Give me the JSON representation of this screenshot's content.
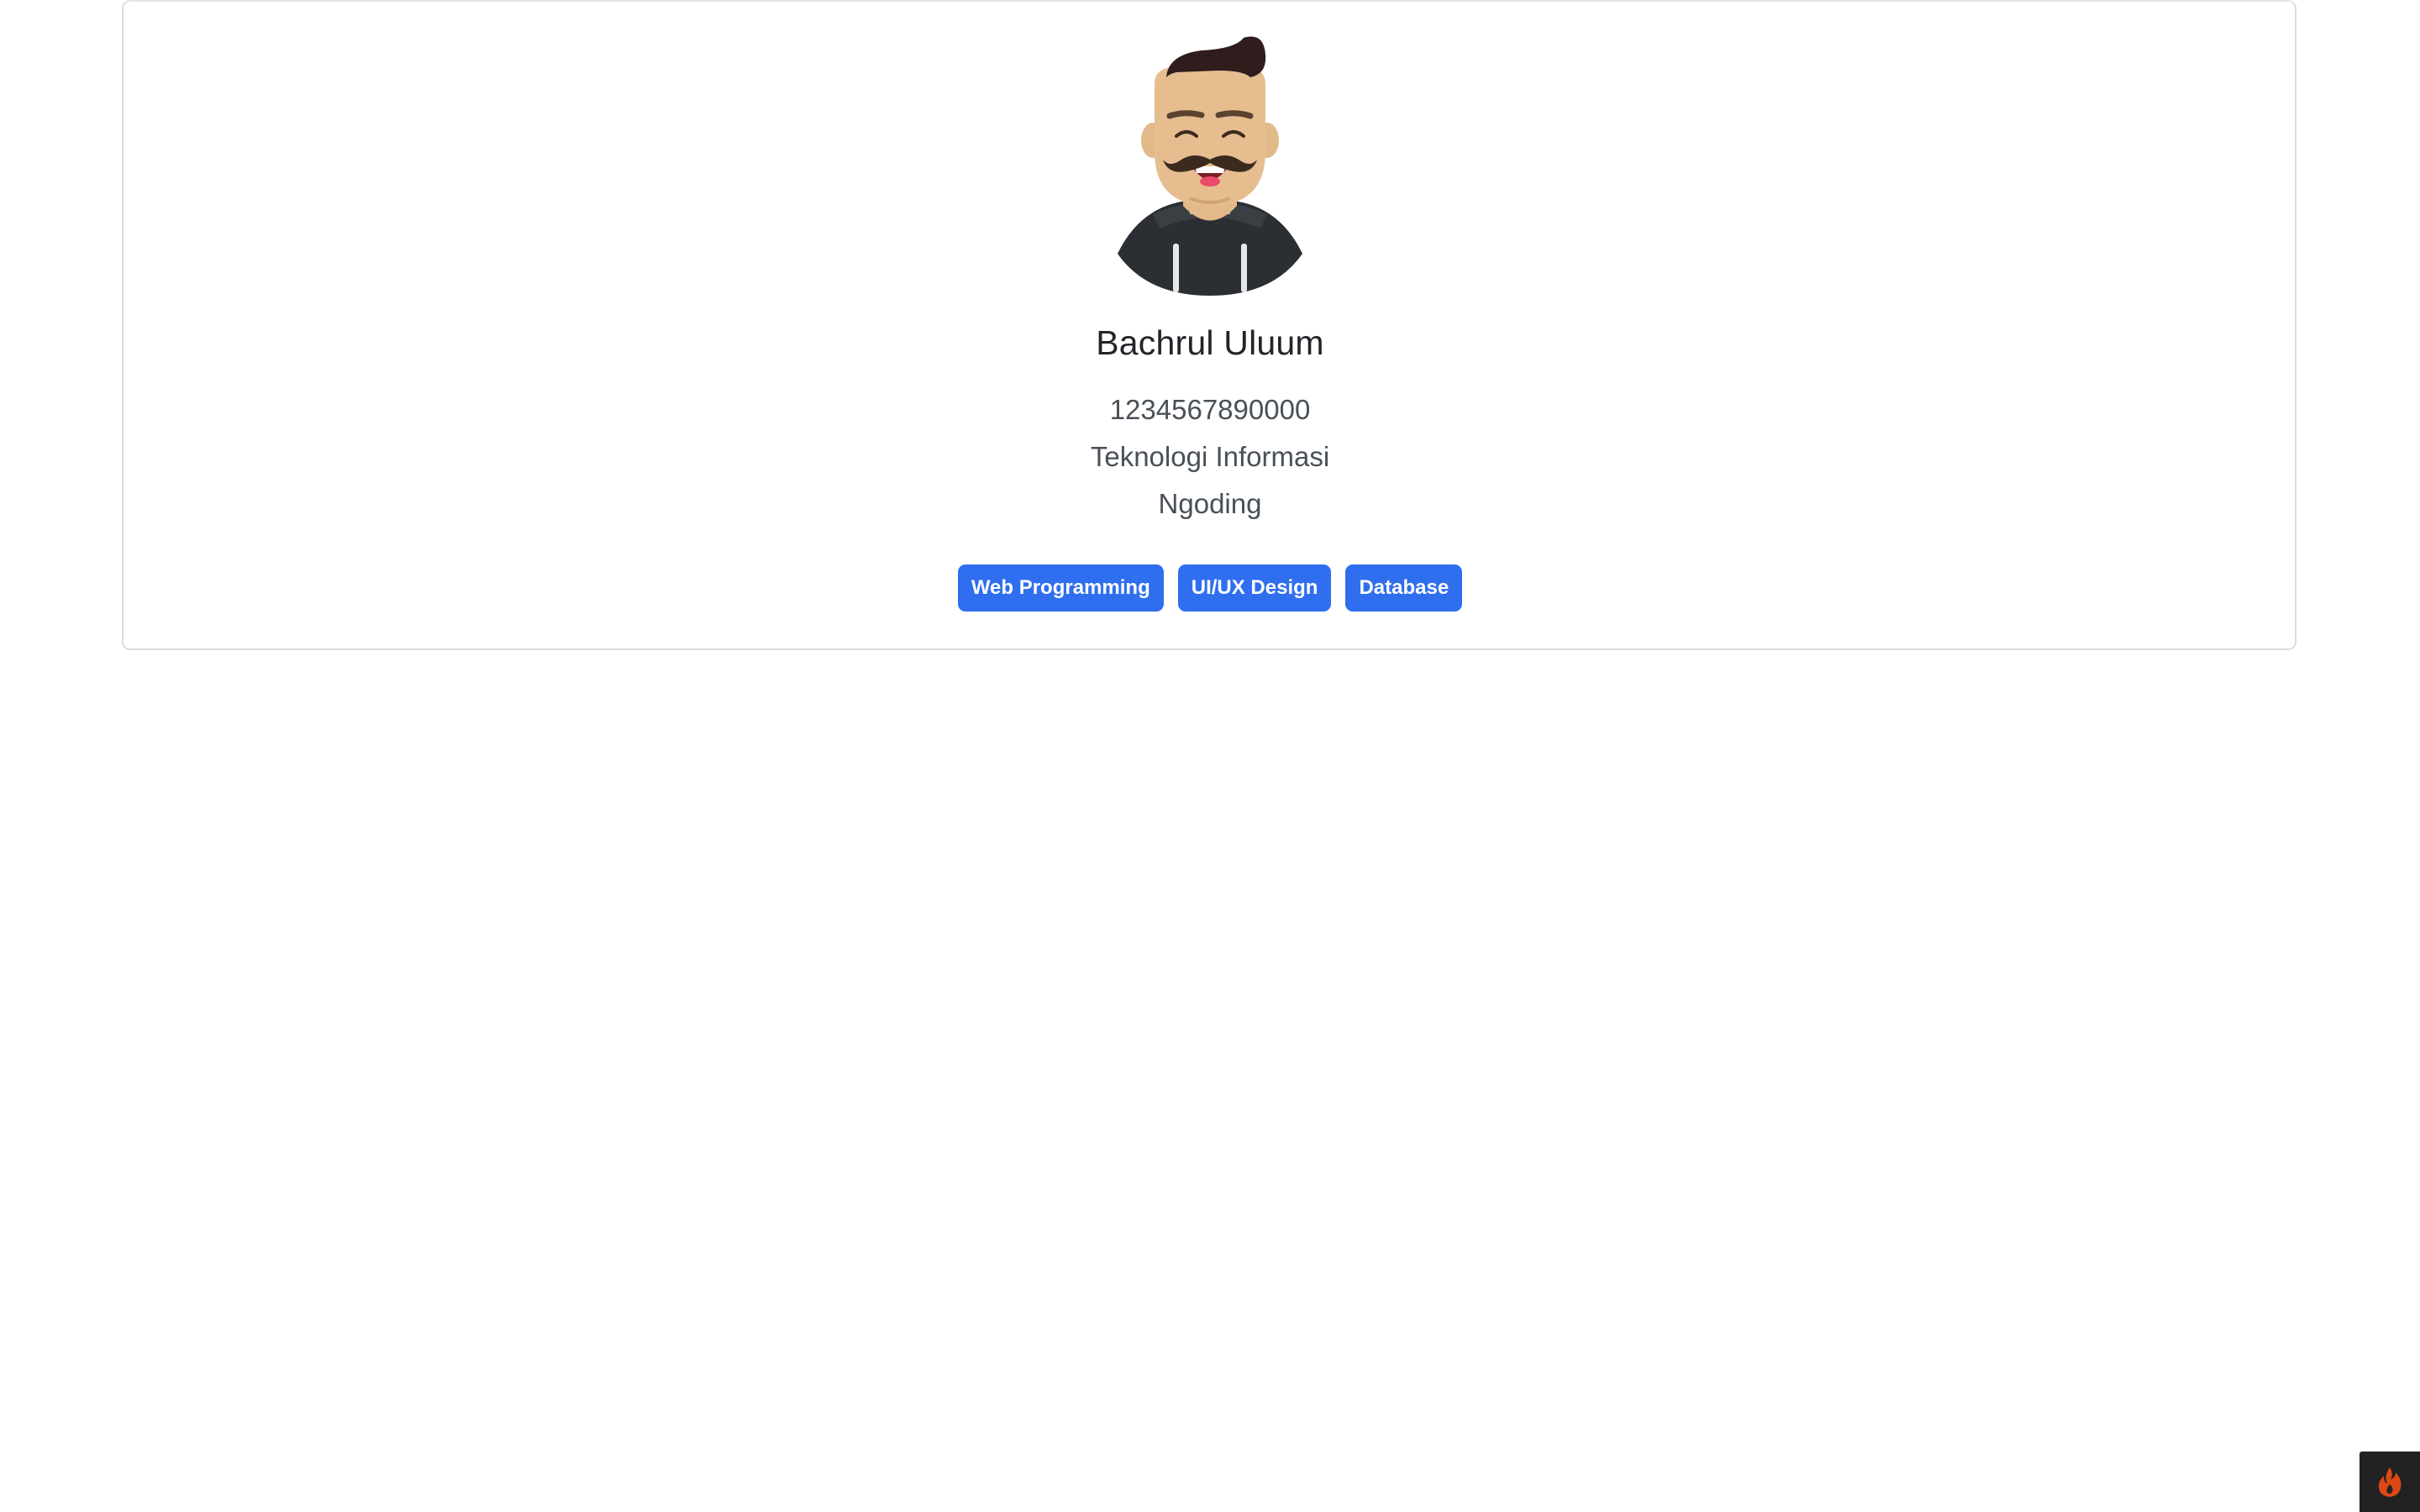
{
  "profile": {
    "name": "Bachrul Uluum",
    "nim": "1234567890000",
    "major": "Teknologi Informasi",
    "hobby": "Ngoding",
    "avatar_icon": "cartoon-man-avatar"
  },
  "skills": [
    {
      "label": "Web Programming"
    },
    {
      "label": "UI/UX Design"
    },
    {
      "label": "Database"
    }
  ],
  "debug_toolbar": {
    "icon": "flame-icon"
  },
  "colors": {
    "badge": "#2f6fef",
    "card_border": "#d9dcdf",
    "name_text": "#212529",
    "detail_text": "#495057",
    "toolbar_bg": "#222222",
    "flame": "#dd4814"
  }
}
